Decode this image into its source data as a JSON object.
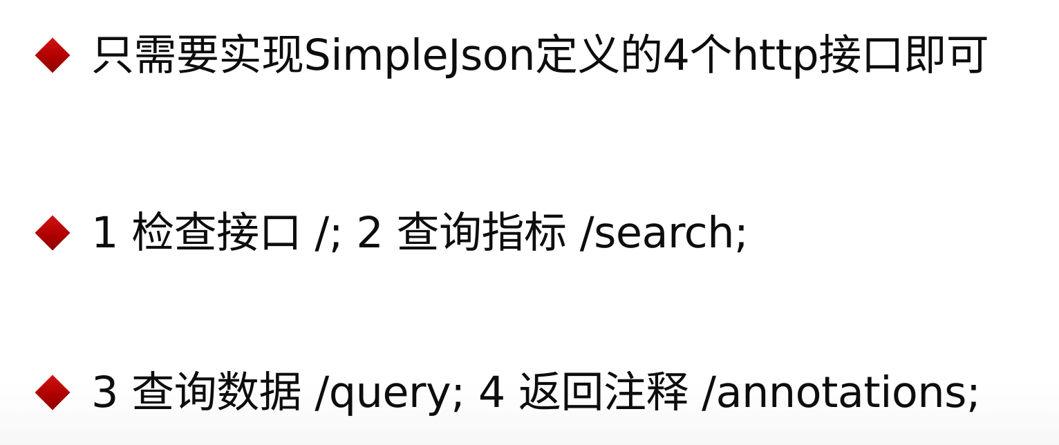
{
  "slide": {
    "bullets": [
      {
        "icon": "red-diamond-bullet-icon",
        "text": "只需要实现SimpleJson定义的4个http接口即可"
      },
      {
        "icon": "red-diamond-bullet-icon",
        "text": "1 检查接口 /; 2 查询指标 /search;"
      },
      {
        "icon": "red-diamond-bullet-icon",
        "text": "3 查询数据 /query; 4 返回注释 /annotations;"
      }
    ],
    "colors": {
      "bullet": "#b00000",
      "text": "#0d0d0d",
      "background": "#ffffff"
    }
  }
}
